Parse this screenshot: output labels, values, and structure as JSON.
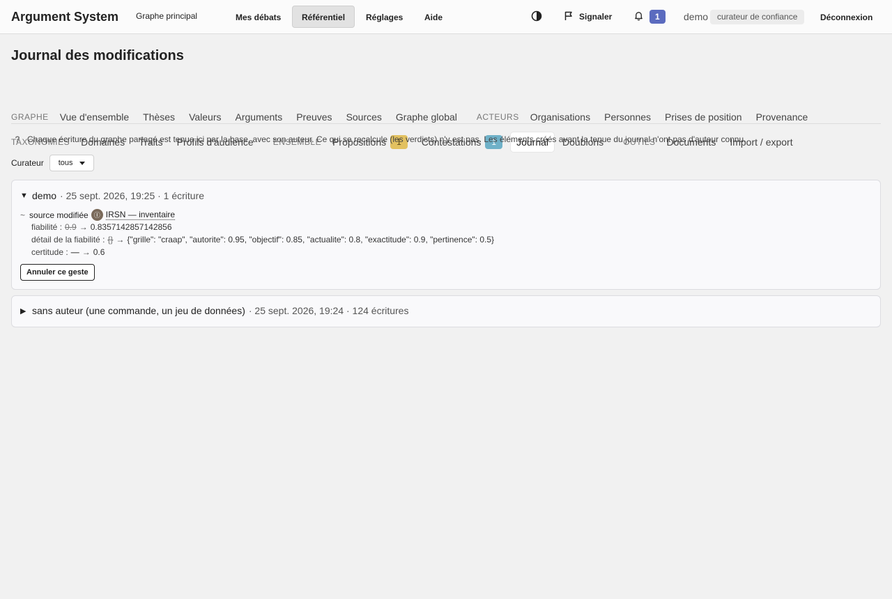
{
  "app": {
    "title": "Argument System",
    "graph_link": "Graphe principal"
  },
  "topnav": {
    "items": [
      "Mes débats",
      "Référentiel",
      "Réglages",
      "Aide"
    ],
    "active": "Référentiel",
    "report_label": "Signaler",
    "notifications_count": "1",
    "user": "demo",
    "role": "curateur de confiance",
    "logout_label": "Déconnexion"
  },
  "page": {
    "title": "Journal des modifications"
  },
  "subnav": {
    "row1": {
      "group_graphe": "GRAPHE",
      "graphe_items": [
        "Vue d'ensemble",
        "Thèses",
        "Valeurs",
        "Arguments",
        "Preuves",
        "Sources",
        "Graphe global"
      ],
      "group_acteurs": "ACTEURS",
      "acteurs_items": [
        "Organisations",
        "Personnes",
        "Prises de position",
        "Provenance"
      ]
    },
    "row2": {
      "group_taxonomies": "TAXONOMIES",
      "taxonomies_items": [
        "Domaines",
        "Traits",
        "Profils d'audience"
      ],
      "group_ensemble": "ENSEMBLE",
      "propositions_label": "Propositions",
      "propositions_count": "1",
      "contestations_label": "Contestations",
      "contestations_count": "1",
      "journal_label": "Journal",
      "doublons_label": "Doublons",
      "group_outils": "OUTILS",
      "outils_items": [
        "Documents",
        "Import / export"
      ]
    }
  },
  "info": {
    "help_icon": "?",
    "text": "Chaque écriture du graphe partagé est tenue ici par la base, avec son auteur. Ce qui se recalcule (les verdicts) n'y est pas. Les éléments créés avant la tenue du journal n'ont pas d'auteur connu."
  },
  "filter": {
    "label": "Curateur",
    "value": "tous"
  },
  "groups": [
    {
      "author": "demo",
      "meta": "· 25 sept. 2026, 19:25 · 1 écriture",
      "expanded": true,
      "entries": [
        {
          "marker": "~",
          "action": "source modifiée",
          "icon_glyph": "Ⓘ",
          "target": "IRSN — inventaire",
          "changes": [
            {
              "field": "fiabilité :",
              "old": "0.9",
              "new": "0.8357142857142856"
            },
            {
              "field": "détail de la fiabilité :",
              "old": "{}",
              "new": "{\"grille\": \"craap\", \"autorite\": 0.95, \"objectif\": 0.85, \"actualite\": 0.8, \"exactitude\": 0.9, \"pertinence\": 0.5}"
            },
            {
              "field": "certitude :",
              "old": "—",
              "new": "0.6"
            }
          ]
        }
      ],
      "undo_label": "Annuler ce geste"
    },
    {
      "author": "sans auteur (une commande, un jeu de données)",
      "meta": "· 25 sept. 2026, 19:24 · 124 écritures",
      "expanded": false
    }
  ]
}
